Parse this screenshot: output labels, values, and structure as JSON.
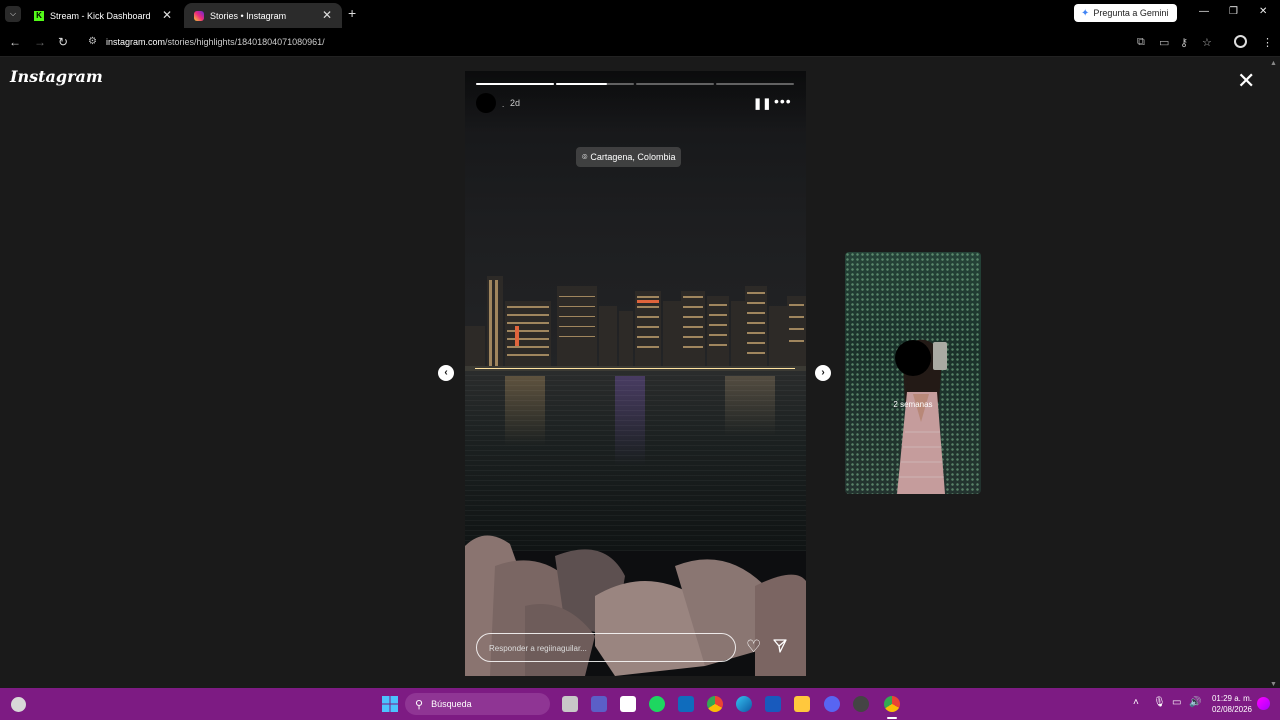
{
  "browser": {
    "tabs": [
      {
        "title": "Stream - Kick Dashboard",
        "active": false
      },
      {
        "title": "Stories • Instagram",
        "active": true
      }
    ],
    "gemini_button": "Pregunta a Gemini",
    "url_host": "instagram.com",
    "url_path": "/stories/highlights/18401804071080961/"
  },
  "page": {
    "logo": "Instagram"
  },
  "story": {
    "progress": [
      1,
      0.65,
      0,
      0
    ],
    "username": ".",
    "time": "2d",
    "location": "Cartagena, Colombia",
    "reply_placeholder": "Responder a regiinaguilar..."
  },
  "next_story": {
    "time": "2 semanas"
  },
  "taskbar": {
    "search_label": "Búsqueda",
    "time": "01:29 a. m.",
    "date": "02/08/2026",
    "app_icons": [
      "windows-start",
      "search",
      "file-explorer-terminal",
      "zoom",
      "calendar-app",
      "spotify",
      "mail",
      "chrome",
      "edge",
      "word",
      "folder",
      "discord",
      "settings",
      "chrome-active"
    ]
  },
  "colors": {
    "taskbar": "#7d1b83",
    "kick_green": "#53fc18",
    "background": "#1a1a1a"
  }
}
